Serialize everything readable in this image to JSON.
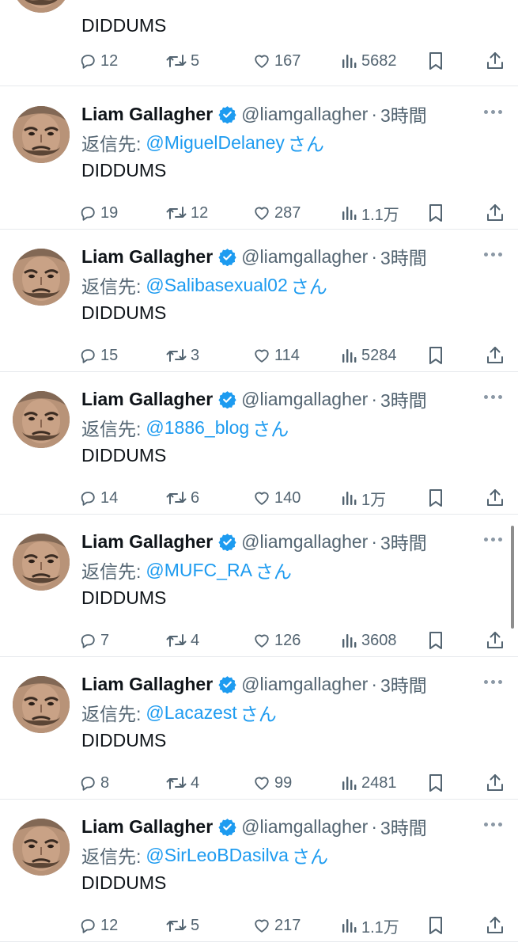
{
  "colors": {
    "text": "#0f1419",
    "secondary": "#536471",
    "link": "#1d9bf0",
    "verified": "#1d9bf0",
    "divider": "#e6e9ec"
  },
  "icons": {
    "reply": "reply-icon",
    "retweet": "retweet-icon",
    "like": "heart-icon",
    "views": "views-icon",
    "bookmark": "bookmark-icon",
    "share": "share-icon",
    "verified": "verified-badge-icon",
    "more": "more-icon"
  },
  "partial_tweet": {
    "text": "DIDDUMS",
    "replies": "12",
    "retweets": "5",
    "likes": "167",
    "views": "5682"
  },
  "tweets": [
    {
      "author_name": "Liam Gallagher",
      "author_handle": "@liamgallagher",
      "time_separator": "·",
      "time": "3時間",
      "reply_prefix": "返信先:",
      "reply_to": "@MiguelDelaney",
      "reply_suffix": "さん",
      "text": "DIDDUMS",
      "replies": "19",
      "retweets": "12",
      "likes": "287",
      "views": "1.1万"
    },
    {
      "author_name": "Liam Gallagher",
      "author_handle": "@liamgallagher",
      "time_separator": "·",
      "time": "3時間",
      "reply_prefix": "返信先:",
      "reply_to": "@Salibasexual02",
      "reply_suffix": "さん",
      "text": "DIDDUMS",
      "replies": "15",
      "retweets": "3",
      "likes": "114",
      "views": "5284"
    },
    {
      "author_name": "Liam Gallagher",
      "author_handle": "@liamgallagher",
      "time_separator": "·",
      "time": "3時間",
      "reply_prefix": "返信先:",
      "reply_to": "@1886_blog",
      "reply_suffix": "さん",
      "text": "DIDDUMS",
      "replies": "14",
      "retweets": "6",
      "likes": "140",
      "views": "1万"
    },
    {
      "author_name": "Liam Gallagher",
      "author_handle": "@liamgallagher",
      "time_separator": "·",
      "time": "3時間",
      "reply_prefix": "返信先:",
      "reply_to": "@MUFC_RA",
      "reply_suffix": "さん",
      "text": "DIDDUMS",
      "replies": "7",
      "retweets": "4",
      "likes": "126",
      "views": "3608"
    },
    {
      "author_name": "Liam Gallagher",
      "author_handle": "@liamgallagher",
      "time_separator": "·",
      "time": "3時間",
      "reply_prefix": "返信先:",
      "reply_to": "@Lacazest",
      "reply_suffix": "さん",
      "text": "DIDDUMS",
      "replies": "8",
      "retweets": "4",
      "likes": "99",
      "views": "2481"
    },
    {
      "author_name": "Liam Gallagher",
      "author_handle": "@liamgallagher",
      "time_separator": "·",
      "time": "3時間",
      "reply_prefix": "返信先:",
      "reply_to": "@SirLeoBDasilva",
      "reply_suffix": "さん",
      "text": "DIDDUMS",
      "replies": "12",
      "retweets": "5",
      "likes": "217",
      "views": "1.1万"
    }
  ]
}
